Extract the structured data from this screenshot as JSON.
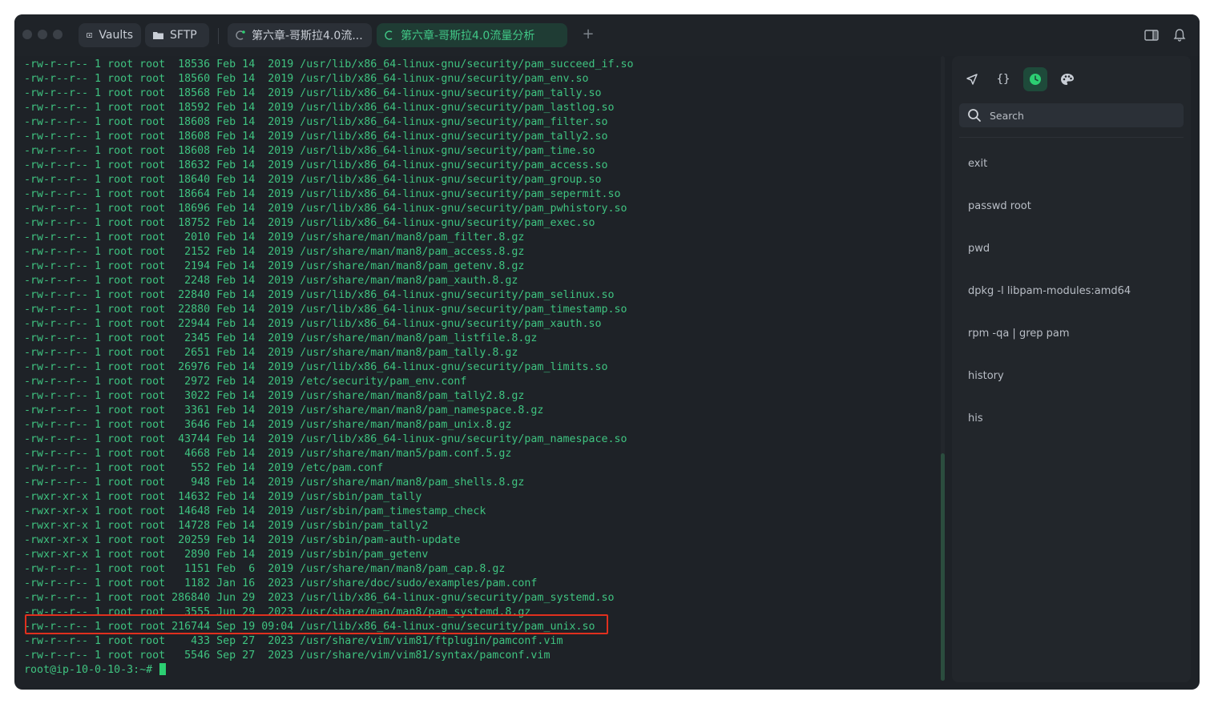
{
  "titlebar": {
    "vaults_label": "Vaults",
    "sftp_label": "SFTP",
    "tabs": [
      {
        "label": "第六章-哥斯拉4.0流..."
      },
      {
        "label": "第六章-哥斯拉4.0流量分析"
      }
    ],
    "new_tab_label": "+"
  },
  "terminal": {
    "lines": [
      "-rw-r--r-- 1 root root  18536 Feb 14  2019 /usr/lib/x86_64-linux-gnu/security/pam_succeed_if.so",
      "-rw-r--r-- 1 root root  18560 Feb 14  2019 /usr/lib/x86_64-linux-gnu/security/pam_env.so",
      "-rw-r--r-- 1 root root  18568 Feb 14  2019 /usr/lib/x86_64-linux-gnu/security/pam_tally.so",
      "-rw-r--r-- 1 root root  18592 Feb 14  2019 /usr/lib/x86_64-linux-gnu/security/pam_lastlog.so",
      "-rw-r--r-- 1 root root  18608 Feb 14  2019 /usr/lib/x86_64-linux-gnu/security/pam_filter.so",
      "-rw-r--r-- 1 root root  18608 Feb 14  2019 /usr/lib/x86_64-linux-gnu/security/pam_tally2.so",
      "-rw-r--r-- 1 root root  18608 Feb 14  2019 /usr/lib/x86_64-linux-gnu/security/pam_time.so",
      "-rw-r--r-- 1 root root  18632 Feb 14  2019 /usr/lib/x86_64-linux-gnu/security/pam_access.so",
      "-rw-r--r-- 1 root root  18640 Feb 14  2019 /usr/lib/x86_64-linux-gnu/security/pam_group.so",
      "-rw-r--r-- 1 root root  18664 Feb 14  2019 /usr/lib/x86_64-linux-gnu/security/pam_sepermit.so",
      "-rw-r--r-- 1 root root  18696 Feb 14  2019 /usr/lib/x86_64-linux-gnu/security/pam_pwhistory.so",
      "-rw-r--r-- 1 root root  18752 Feb 14  2019 /usr/lib/x86_64-linux-gnu/security/pam_exec.so",
      "-rw-r--r-- 1 root root   2010 Feb 14  2019 /usr/share/man/man8/pam_filter.8.gz",
      "-rw-r--r-- 1 root root   2152 Feb 14  2019 /usr/share/man/man8/pam_access.8.gz",
      "-rw-r--r-- 1 root root   2194 Feb 14  2019 /usr/share/man/man8/pam_getenv.8.gz",
      "-rw-r--r-- 1 root root   2248 Feb 14  2019 /usr/share/man/man8/pam_xauth.8.gz",
      "-rw-r--r-- 1 root root  22840 Feb 14  2019 /usr/lib/x86_64-linux-gnu/security/pam_selinux.so",
      "-rw-r--r-- 1 root root  22880 Feb 14  2019 /usr/lib/x86_64-linux-gnu/security/pam_timestamp.so",
      "-rw-r--r-- 1 root root  22944 Feb 14  2019 /usr/lib/x86_64-linux-gnu/security/pam_xauth.so",
      "-rw-r--r-- 1 root root   2345 Feb 14  2019 /usr/share/man/man8/pam_listfile.8.gz",
      "-rw-r--r-- 1 root root   2651 Feb 14  2019 /usr/share/man/man8/pam_tally.8.gz",
      "-rw-r--r-- 1 root root  26976 Feb 14  2019 /usr/lib/x86_64-linux-gnu/security/pam_limits.so",
      "-rw-r--r-- 1 root root   2972 Feb 14  2019 /etc/security/pam_env.conf",
      "-rw-r--r-- 1 root root   3022 Feb 14  2019 /usr/share/man/man8/pam_tally2.8.gz",
      "-rw-r--r-- 1 root root   3361 Feb 14  2019 /usr/share/man/man8/pam_namespace.8.gz",
      "-rw-r--r-- 1 root root   3646 Feb 14  2019 /usr/share/man/man8/pam_unix.8.gz",
      "-rw-r--r-- 1 root root  43744 Feb 14  2019 /usr/lib/x86_64-linux-gnu/security/pam_namespace.so",
      "-rw-r--r-- 1 root root   4668 Feb 14  2019 /usr/share/man/man5/pam.conf.5.gz",
      "-rw-r--r-- 1 root root    552 Feb 14  2019 /etc/pam.conf",
      "-rw-r--r-- 1 root root    948 Feb 14  2019 /usr/share/man/man8/pam_shells.8.gz",
      "-rwxr-xr-x 1 root root  14632 Feb 14  2019 /usr/sbin/pam_tally",
      "-rwxr-xr-x 1 root root  14648 Feb 14  2019 /usr/sbin/pam_timestamp_check",
      "-rwxr-xr-x 1 root root  14728 Feb 14  2019 /usr/sbin/pam_tally2",
      "-rwxr-xr-x 1 root root  20259 Feb 14  2019 /usr/sbin/pam-auth-update",
      "-rwxr-xr-x 1 root root   2890 Feb 14  2019 /usr/sbin/pam_getenv",
      "-rw-r--r-- 1 root root   1151 Feb  6  2019 /usr/share/man/man8/pam_cap.8.gz",
      "-rw-r--r-- 1 root root   1182 Jan 16  2023 /usr/share/doc/sudo/examples/pam.conf",
      "-rw-r--r-- 1 root root 286840 Jun 29  2023 /usr/lib/x86_64-linux-gnu/security/pam_systemd.so",
      "-rw-r--r-- 1 root root   3555 Jun 29  2023 /usr/share/man/man8/pam_systemd.8.gz",
      "-rw-r--r-- 1 root root 216744 Sep 19 09:04 /usr/lib/x86_64-linux-gnu/security/pam_unix.so",
      "-rw-r--r-- 1 root root    433 Sep 27  2023 /usr/share/vim/vim81/ftplugin/pamconf.vim",
      "-rw-r--r-- 1 root root   5546 Sep 27  2023 /usr/share/vim/vim81/syntax/pamconf.vim"
    ],
    "prompt": "root@ip-10-0-10-3:~# "
  },
  "panel": {
    "search_placeholder": "Search",
    "history": [
      "exit",
      "passwd root",
      "pwd",
      "dpkg -l libpam-modules:amd64",
      "rpm -qa | grep pam",
      "history",
      "his"
    ]
  },
  "colors": {
    "terminal_text": "#3fc380",
    "highlight_box": "#e0301e",
    "accent": "#2ccf72",
    "background": "#1e2227"
  }
}
